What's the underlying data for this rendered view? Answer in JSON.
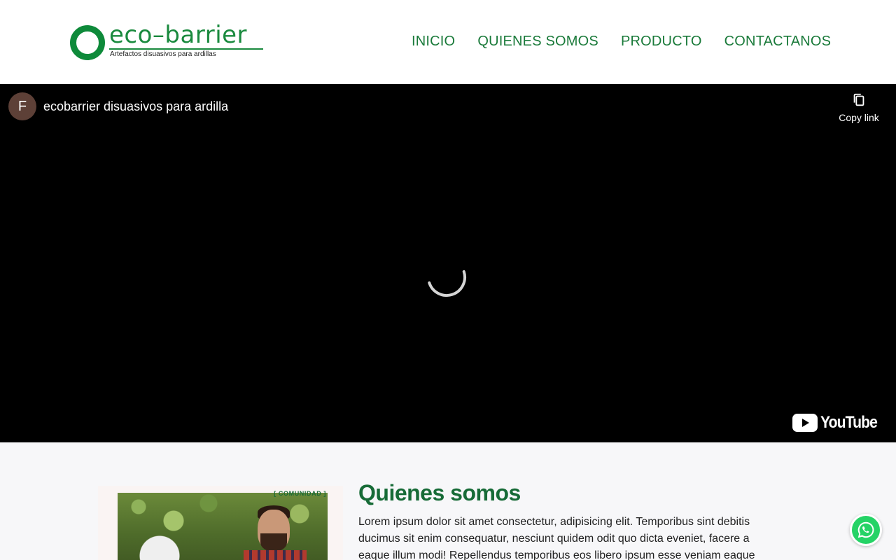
{
  "header": {
    "logo_name": "eco–barrier",
    "logo_tagline": "Artefactos disuasivos para ardillas",
    "nav": [
      {
        "label": "INICIO"
      },
      {
        "label": "QUIENES SOMOS"
      },
      {
        "label": "PRODUCTO"
      },
      {
        "label": "CONTACTANOS"
      }
    ]
  },
  "video": {
    "channel_initial": "F",
    "title": "ecobarrier disuasivos para ardilla",
    "copy_link_label": "Copy link",
    "copy_icon": "copy-icon",
    "provider_label": "YouTube",
    "state": "loading"
  },
  "about": {
    "image_badge": "[ COMUNIDAD ]",
    "title": "Quienes somos",
    "text": "Lorem ipsum dolor sit amet consectetur, adipisicing elit. Temporibus sint debitis ducimus sit enim consequatur, nesciunt quidem odit quo dicta eveniet, facere a eaque illum modi! Repellendus temporibus eos libero ipsum esse veniam eaque"
  },
  "floating": {
    "whatsapp_icon": "whatsapp-icon"
  },
  "colors": {
    "brand_green": "#1a7a3a",
    "heading_green": "#176b37",
    "video_bg": "#000000",
    "whatsapp_green": "#25d366"
  }
}
